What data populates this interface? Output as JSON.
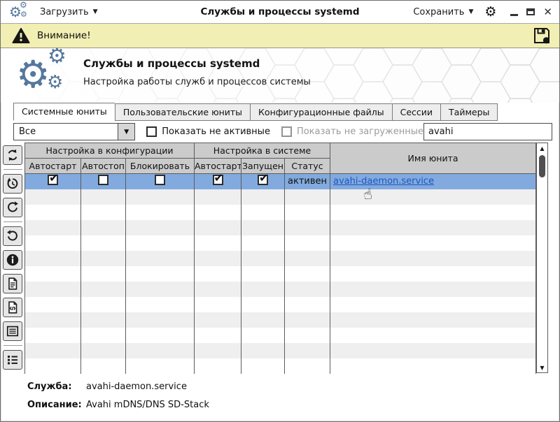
{
  "titlebar": {
    "load_label": "Загрузить",
    "title": "Службы и процессы systemd",
    "save_label": "Сохранить"
  },
  "warning_bar": {
    "text": "Внимание!"
  },
  "banner": {
    "title": "Службы и процессы systemd",
    "subtitle": "Настройка работы служб и процессов системы"
  },
  "tabs": [
    {
      "label": "Системные юниты",
      "active": true
    },
    {
      "label": "Пользовательские юниты",
      "active": false
    },
    {
      "label": "Конфигурационные файлы",
      "active": false
    },
    {
      "label": "Сессии",
      "active": false
    },
    {
      "label": "Таймеры",
      "active": false
    }
  ],
  "filters": {
    "unit_type_value": "Все",
    "show_inactive_label": "Показать не активные",
    "show_inactive_checked": false,
    "show_unloaded_label": "Показать не загруженные",
    "show_unloaded_checked": false,
    "search_value": "avahi"
  },
  "toolbar": {
    "button_icons": [
      "refresh-icon",
      "history-undo-icon",
      "redo-icon",
      "undo-icon",
      "info-icon",
      "document-icon",
      "source-file-icon",
      "list-box-icon",
      "bullet-list-icon"
    ]
  },
  "table": {
    "group_headers": {
      "config": "Настройка в конфигурации",
      "system": "Настройка в системе",
      "unit_name": "Имя юнита"
    },
    "sub_headers": {
      "autostart_cfg": "Автостарт",
      "autostop_cfg": "Автостоп",
      "block_cfg": "Блокировать",
      "autostart_sys": "Автостарт",
      "running": "Запущен",
      "status": "Статус"
    },
    "rows": [
      {
        "autostart_cfg": true,
        "autostop_cfg": false,
        "block_cfg": false,
        "autostart_sys": true,
        "running": true,
        "status": "активен",
        "unit_name": "avahi-daemon.service",
        "selected": true
      }
    ],
    "empty_row_count": 12
  },
  "details": {
    "service_label": "Служба:",
    "service_value": "avahi-daemon.service",
    "description_label": "Описание:",
    "description_value": "Avahi mDNS/DNS SD-Stack"
  },
  "colors": {
    "accent_blue": "#54779e",
    "selected_row": "#82aade",
    "warning_bg": "#f1efb3",
    "table_header_bg": "#cbcbcb",
    "link_blue": "#1d56c2",
    "stripe_gray": "#efefef"
  }
}
